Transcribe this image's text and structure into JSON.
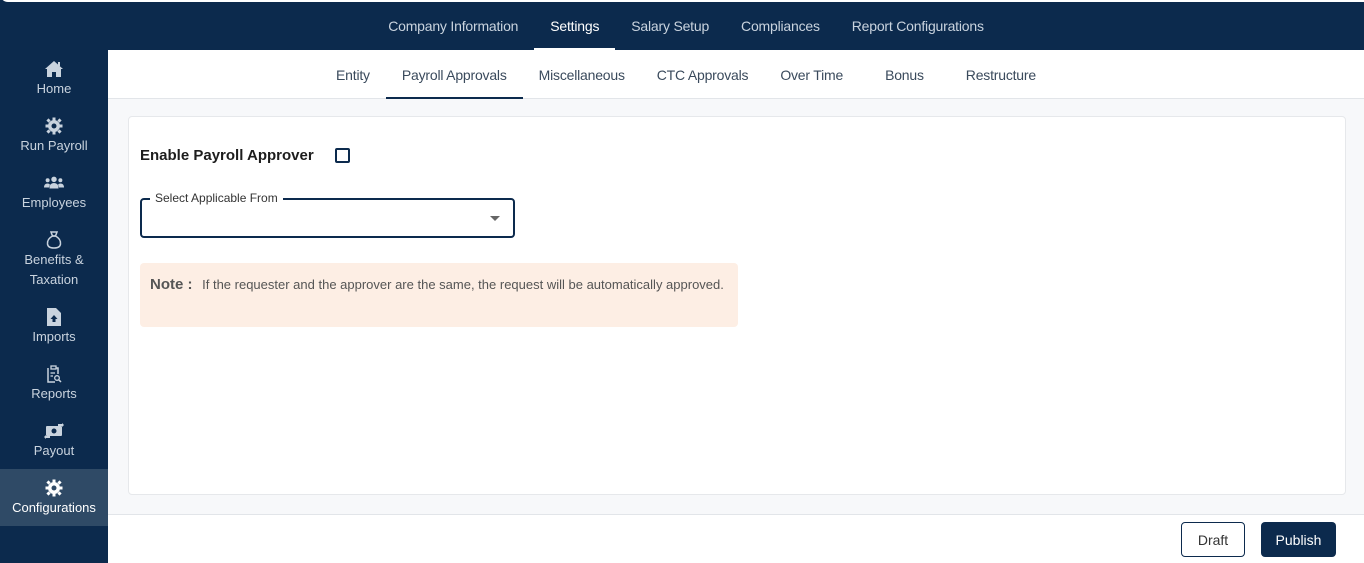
{
  "top_nav": {
    "tabs": [
      {
        "label": "Company Information",
        "active": false
      },
      {
        "label": "Settings",
        "active": true
      },
      {
        "label": "Salary Setup",
        "active": false
      },
      {
        "label": "Compliances",
        "active": false
      },
      {
        "label": "Report Configurations",
        "active": false
      }
    ]
  },
  "sidebar": {
    "items": [
      {
        "label": "Home",
        "icon": "home-icon"
      },
      {
        "label": "Run Payroll",
        "icon": "gear-icon"
      },
      {
        "label": "Employees",
        "icon": "users-icon"
      },
      {
        "label": "Benefits & Taxation",
        "icon": "money-bag-icon"
      },
      {
        "label": "Imports",
        "icon": "file-upload-icon"
      },
      {
        "label": "Reports",
        "icon": "clipboard-search-icon"
      },
      {
        "label": "Payout",
        "icon": "money-transfer-icon"
      },
      {
        "label": "Configurations",
        "icon": "gear-icon",
        "active": true
      }
    ]
  },
  "sub_nav": {
    "tabs": [
      {
        "label": "Entity",
        "active": false
      },
      {
        "label": "Payroll Approvals",
        "active": true
      },
      {
        "label": "Miscellaneous",
        "active": false
      },
      {
        "label": "CTC Approvals",
        "active": false
      },
      {
        "label": "Over Time",
        "active": false
      },
      {
        "label": "Bonus",
        "active": false
      },
      {
        "label": "Restructure",
        "active": false
      }
    ]
  },
  "form": {
    "enable_label": "Enable Payroll Approver",
    "enable_checked": false,
    "select_label": "Select Applicable From",
    "select_value": "",
    "note_title": "Note :",
    "note_text": "If the requester and the approver are the same, the request will be automatically approved."
  },
  "footer": {
    "draft_label": "Draft",
    "publish_label": "Publish"
  },
  "colors": {
    "brand": "#0c2a4d",
    "note_bg": "#fdeee4",
    "active_sidebar": "#2f4a66"
  }
}
